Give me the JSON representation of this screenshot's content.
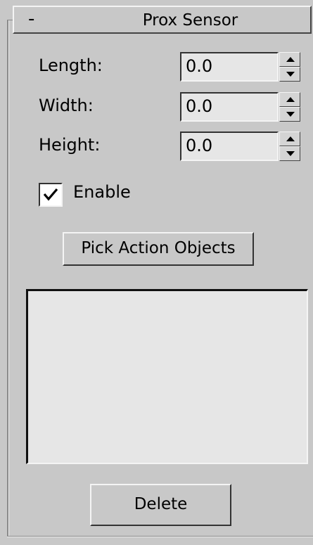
{
  "rollout": {
    "toggle": "-",
    "title": "Prox Sensor"
  },
  "fields": [
    {
      "label": "Length:",
      "value": "0.0"
    },
    {
      "label": "Width:",
      "value": "0.0"
    },
    {
      "label": "Height:",
      "value": "0.0"
    }
  ],
  "enable": {
    "label": "Enable",
    "checked": true
  },
  "buttons": {
    "pick_action_objects": "Pick Action Objects",
    "delete": "Delete"
  },
  "action_objects_list": []
}
